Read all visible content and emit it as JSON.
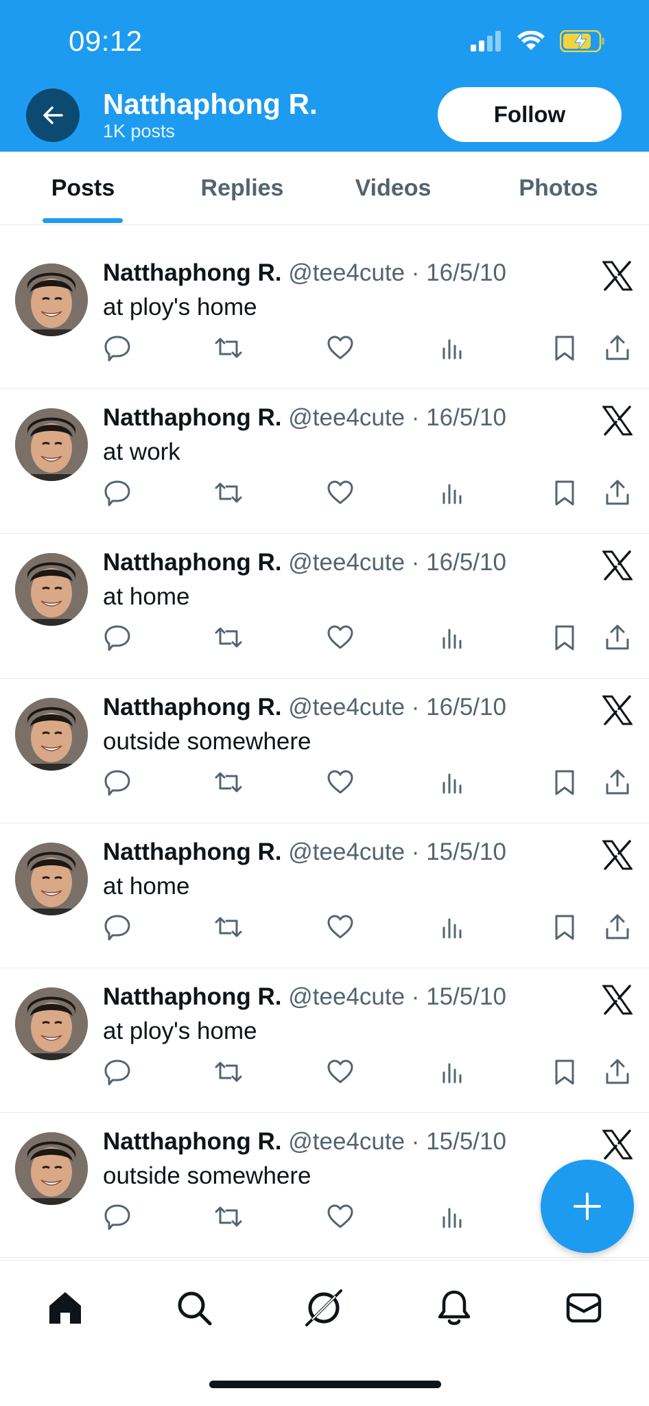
{
  "status_bar": {
    "time": "09:12"
  },
  "header": {
    "name": "Natthaphong R.",
    "post_count": "1K posts",
    "follow_label": "Follow",
    "background_color": "#1d9bf0"
  },
  "tabs": [
    {
      "label": "Posts",
      "active": true
    },
    {
      "label": "Replies",
      "active": false
    },
    {
      "label": "Videos",
      "active": false
    },
    {
      "label": "Photos",
      "active": false
    }
  ],
  "posts": [
    {
      "author": "Natthaphong R.",
      "handle": "@tee4cute",
      "separator": "·",
      "date": "16/5/10",
      "text": "at ploy's home"
    },
    {
      "author": "Natthaphong R.",
      "handle": "@tee4cute",
      "separator": "·",
      "date": "16/5/10",
      "text": "at work"
    },
    {
      "author": "Natthaphong R.",
      "handle": "@tee4cute",
      "separator": "·",
      "date": "16/5/10",
      "text": "at home"
    },
    {
      "author": "Natthaphong R.",
      "handle": "@tee4cute",
      "separator": "·",
      "date": "16/5/10",
      "text": "outside somewhere"
    },
    {
      "author": "Natthaphong R.",
      "handle": "@tee4cute",
      "separator": "·",
      "date": "15/5/10",
      "text": "at home"
    },
    {
      "author": "Natthaphong R.",
      "handle": "@tee4cute",
      "separator": "·",
      "date": "15/5/10",
      "text": "at ploy's home"
    },
    {
      "author": "Natthaphong R.",
      "handle": "@tee4cute",
      "separator": "·",
      "date": "15/5/10",
      "text": "outside somewhere"
    }
  ],
  "post_actions": [
    "reply-icon",
    "repost-icon",
    "like-icon",
    "views-icon",
    "bookmark-icon",
    "share-icon"
  ],
  "fab": {
    "icon": "plus-icon"
  },
  "bottom_nav": [
    "home-icon",
    "search-icon",
    "grok-icon",
    "notifications-icon",
    "messages-icon"
  ]
}
